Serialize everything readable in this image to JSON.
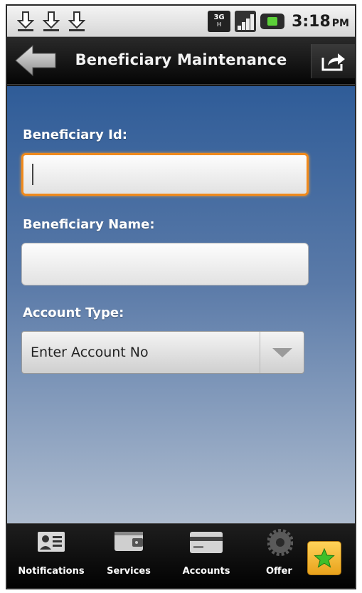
{
  "app": {
    "title": "Beneficiary Maintenance"
  },
  "status_bar": {
    "network_type": "3G",
    "network_sub": "H",
    "time": "3:18",
    "ampm": "PM",
    "download_notifications": [
      "download-icon",
      "download-icon",
      "download-icon"
    ]
  },
  "form": {
    "beneficiary_id_label": "Beneficiary Id:",
    "beneficiary_id_value": "",
    "beneficiary_name_label": "Beneficiary Name:",
    "beneficiary_name_value": "",
    "account_type_label": "Account Type:",
    "account_type_selected": "Enter Account No"
  },
  "bottom_nav": {
    "items": [
      {
        "label": "Notifications",
        "icon": "contact-card-icon"
      },
      {
        "label": "Services",
        "icon": "wallet-icon"
      },
      {
        "label": "Accounts",
        "icon": "credit-card-icon"
      },
      {
        "label": "Offer",
        "icon": "gear-icon"
      }
    ],
    "favorite_icon": "star-icon"
  },
  "colors": {
    "focus_border": "#f08a1c",
    "content_gradient_top": "#2f5c98",
    "content_gradient_bottom": "#aebccf",
    "battery_green": "#5cd039",
    "star_green": "#3fbf2a",
    "favorite_bg": "#f2b52e"
  }
}
